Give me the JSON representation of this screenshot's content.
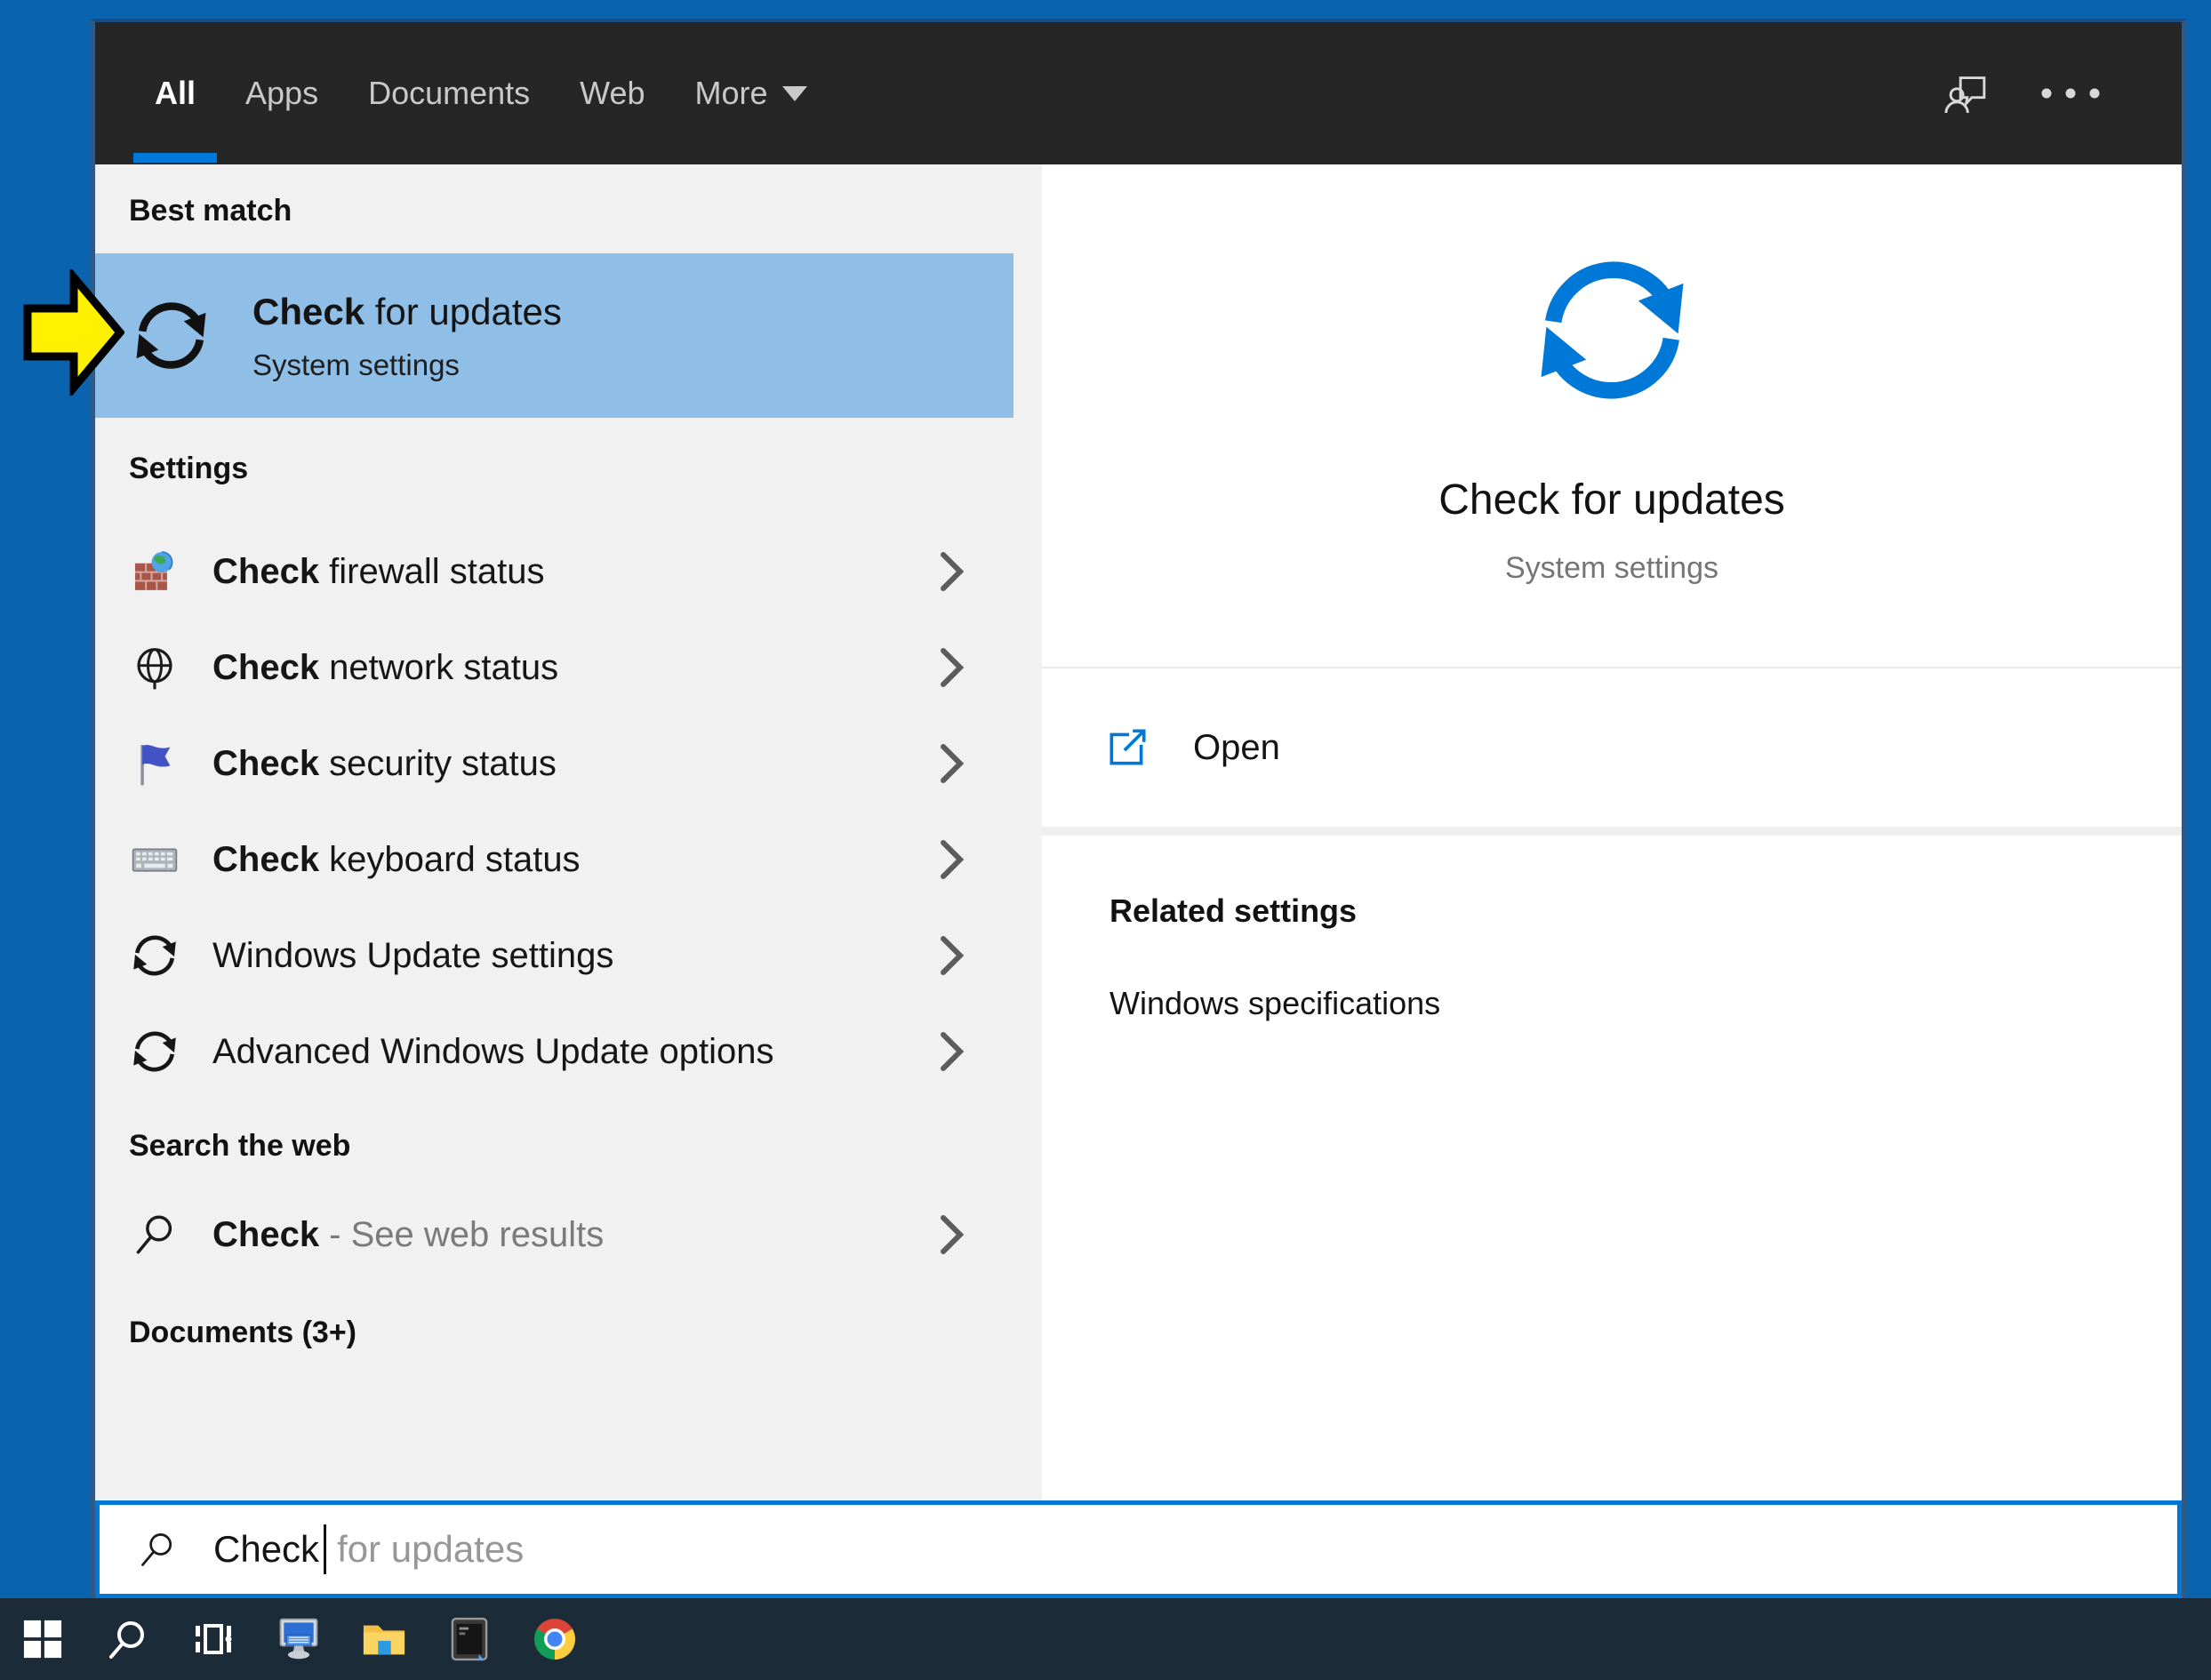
{
  "window": {
    "tabs": [
      {
        "label": "All",
        "active": true
      },
      {
        "label": "Apps",
        "active": false
      },
      {
        "label": "Documents",
        "active": false
      },
      {
        "label": "Web",
        "active": false
      },
      {
        "label": "More",
        "active": false,
        "dropdown": true
      }
    ],
    "header_icons": [
      "user-feedback-icon",
      "more-options-icon"
    ]
  },
  "results": {
    "best_match_label": "Best match",
    "best_match": {
      "title_bold": "Check",
      "title_rest": " for updates",
      "subtitle": "System settings",
      "icon": "refresh-icon"
    },
    "settings_label": "Settings",
    "settings_items": [
      {
        "bold": "Check",
        "rest": " firewall status",
        "icon": "firewall-icon"
      },
      {
        "bold": "Check",
        "rest": " network status",
        "icon": "globe-icon"
      },
      {
        "bold": "Check",
        "rest": " security status",
        "icon": "flag-icon"
      },
      {
        "bold": "Check",
        "rest": " keyboard status",
        "icon": "keyboard-icon"
      },
      {
        "bold": "",
        "rest": "Windows Update settings",
        "icon": "refresh-icon"
      },
      {
        "bold": "",
        "rest": "Advanced Windows Update options",
        "icon": "refresh-icon"
      }
    ],
    "web_label": "Search the web",
    "web_item": {
      "bold": "Check",
      "rest": " - See web results",
      "icon": "search-icon"
    },
    "documents_label": "Documents (3+)"
  },
  "preview": {
    "title": "Check for updates",
    "subtitle": "System settings",
    "open_label": "Open",
    "related_label": "Related settings",
    "related_items": [
      "Windows specifications"
    ]
  },
  "search": {
    "typed": "Check",
    "suggestion": "for updates"
  },
  "taskbar": {
    "items": [
      "start",
      "search",
      "task-view",
      "touch-keyboard",
      "file-explorer",
      "terminal",
      "chrome"
    ]
  },
  "colors": {
    "desktop": "#0A63AE",
    "accent": "#0078D7",
    "highlight": "#8FBEE6",
    "header": "#262626",
    "taskbar": "#1C2B38"
  }
}
